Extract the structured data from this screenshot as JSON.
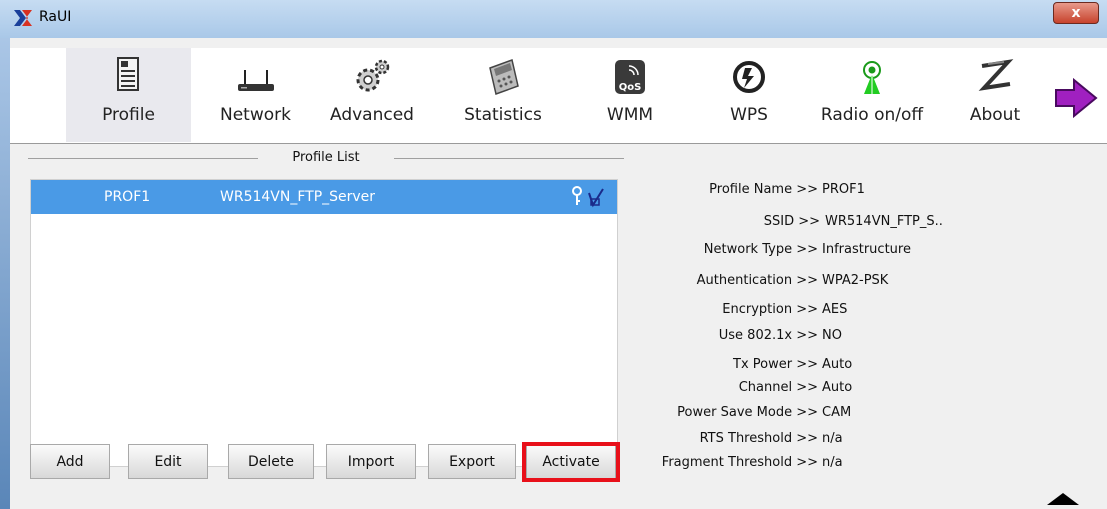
{
  "window": {
    "title": "RaUI",
    "close_label": "x"
  },
  "toolbar": {
    "items": [
      {
        "label": "Profile"
      },
      {
        "label": "Network"
      },
      {
        "label": "Advanced"
      },
      {
        "label": "Statistics"
      },
      {
        "label": "WMM"
      },
      {
        "label": "WPS"
      },
      {
        "label": "Radio on/off"
      },
      {
        "label": "About"
      }
    ],
    "wmm_icon_text": "QoS"
  },
  "profile_list": {
    "title": "Profile List",
    "rows": [
      {
        "profile": "PROF1",
        "ssid": "WR514VN_FTP_Server"
      }
    ]
  },
  "buttons": {
    "add": "Add",
    "edit": "Edit",
    "delete": "Delete",
    "import": "Import",
    "export": "Export",
    "activate": "Activate"
  },
  "details": [
    {
      "label": "Profile Name >>",
      "value": "PROF1"
    },
    {
      "label": "SSID >>",
      "value": "WR514VN_FTP_S.."
    },
    {
      "label": "Network Type >>",
      "value": "Infrastructure"
    },
    {
      "label": "Authentication >>",
      "value": "WPA2-PSK"
    },
    {
      "label": "Encryption >>",
      "value": "AES"
    },
    {
      "label": "Use 802.1x >>",
      "value": "NO"
    },
    {
      "label": "Tx Power >>",
      "value": "Auto"
    },
    {
      "label": "Channel >>",
      "value": "Auto"
    },
    {
      "label": "Power Save Mode >>",
      "value": "CAM"
    },
    {
      "label": "RTS Threshold >>",
      "value": "n/a"
    },
    {
      "label": "Fragment Threshold >>",
      "value": "n/a"
    }
  ],
  "colors": {
    "selection": "#4a9ae6",
    "highlight": "#e8101a",
    "arrow": "#a020c0"
  }
}
